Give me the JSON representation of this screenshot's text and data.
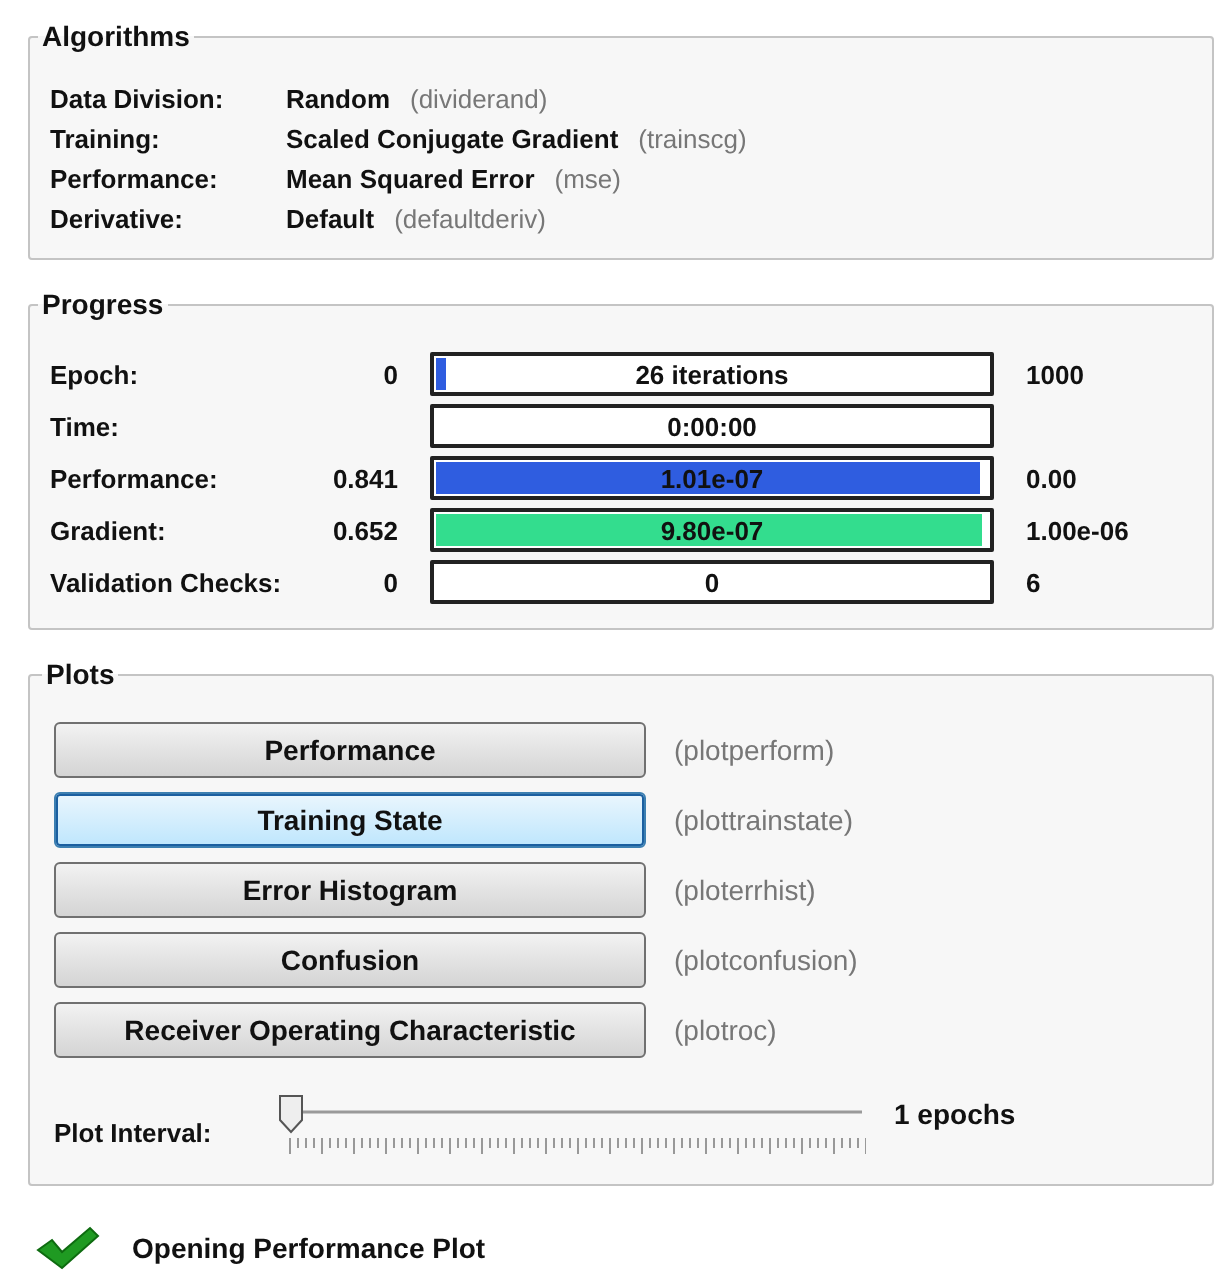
{
  "algorithms": {
    "title": "Algorithms",
    "rows": [
      {
        "label": "Data Division:",
        "value": "Random",
        "function": "(dividerand)"
      },
      {
        "label": "Training:",
        "value": "Scaled Conjugate Gradient",
        "function": "(trainscg)"
      },
      {
        "label": "Performance:",
        "value": "Mean Squared Error",
        "function": "(mse)"
      },
      {
        "label": "Derivative:",
        "value": "Default",
        "function": "(defaultderiv)"
      }
    ]
  },
  "progress": {
    "title": "Progress",
    "rows": [
      {
        "label": "Epoch:",
        "start": "0",
        "bar_text": "26 iterations",
        "level": 0.026,
        "color": "#2f5de0",
        "end": "1000"
      },
      {
        "label": "Time:",
        "bar_text": "0:00:00"
      },
      {
        "label": "Performance:",
        "start": "0.841",
        "bar_text": "1.01e-07",
        "level": 0.985,
        "color": "#2f5de0",
        "end": "0.00"
      },
      {
        "label": "Gradient:",
        "start": "0.652",
        "bar_text": "9.80e-07",
        "level": 0.99,
        "color": "#33dd8e",
        "end": "1.00e-06"
      },
      {
        "label": "Validation Checks:",
        "start": "0",
        "bar_text": "0",
        "end": "6"
      }
    ]
  },
  "plots": {
    "title": "Plots",
    "buttons": [
      {
        "label": "Performance",
        "function": "(plotperform)",
        "selected": false
      },
      {
        "label": "Training State",
        "function": "(plottrainstate)",
        "selected": true
      },
      {
        "label": "Error Histogram",
        "function": "(ploterrhist)",
        "selected": false
      },
      {
        "label": "Confusion",
        "function": "(plotconfusion)",
        "selected": false
      },
      {
        "label": "Receiver Operating Characteristic",
        "function": "(plotroc)",
        "selected": false
      }
    ],
    "slider": {
      "label": "Plot Interval:",
      "level": 0,
      "reading": "1 epochs"
    }
  },
  "status": {
    "text": "Opening Performance Plot"
  }
}
